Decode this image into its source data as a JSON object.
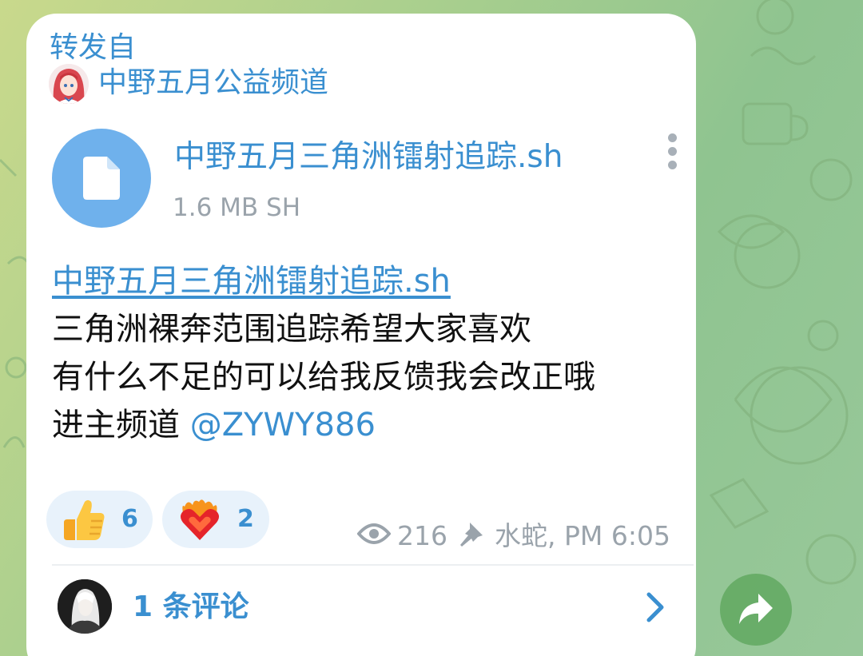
{
  "forward": {
    "label": "转发自",
    "channel_name": "中野五月公益频道"
  },
  "file": {
    "name": "中野五月三角洲镭射追踪.sh",
    "meta": "1.6 MB SH",
    "icon": "document-icon"
  },
  "message": {
    "link_text": "中野五月三角洲镭射追踪.sh",
    "line1": "三角洲裸奔范围追踪希望大家喜欢",
    "line2": "有什么不足的可以给我反馈我会改正哦",
    "line3_prefix": "进主频道 ",
    "mention": "@ZYWY886"
  },
  "reactions": [
    {
      "emoji": "thumbs-up-icon",
      "count": "6"
    },
    {
      "emoji": "heart-on-fire-icon",
      "count": "2"
    }
  ],
  "meta": {
    "views": "216",
    "time": "水蛇, PM 6:05",
    "views_icon": "eye-icon",
    "pin_icon": "pin-icon"
  },
  "comments": {
    "label": "1 条评论"
  },
  "colors": {
    "accent": "#3a8fd0",
    "file_circle": "#6fb1ec",
    "reaction_bg": "#e8f2fb",
    "meta_gray": "#9aa3ab",
    "share_button": "#62a860"
  }
}
